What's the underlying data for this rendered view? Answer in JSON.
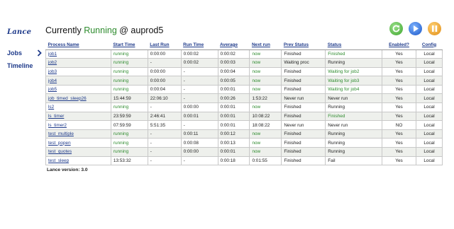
{
  "header": {
    "logo": "Lance",
    "title_prefix": "Currently",
    "status": "Running",
    "title_suffix": "@ auprod5"
  },
  "sidebar": {
    "items": [
      {
        "label": "Jobs"
      },
      {
        "label": "Timeline"
      }
    ]
  },
  "table": {
    "columns": [
      "Process Name",
      "Start Time",
      "Last Run",
      "Run Time",
      "Average",
      "Next run",
      "Prev Status",
      "Status",
      "Enabled?",
      "Config"
    ],
    "rows": [
      [
        "job1",
        "running",
        "0:00:00",
        "0:00:02",
        "0:00:02",
        "now",
        "Finished",
        "Finished",
        "Yes",
        "Local"
      ],
      [
        "job2",
        "running",
        "-",
        "0:00:02",
        "0:00:03",
        "now",
        "Waiting proc",
        "Running",
        "Yes",
        "Local"
      ],
      [
        "job3",
        "running",
        "0:00:00",
        "-",
        "0:00:04",
        "now",
        "Finished",
        "Waiting for job2",
        "Yes",
        "Local"
      ],
      [
        "job4",
        "running",
        "0:00:00",
        "-",
        "0:00:05",
        "now",
        "Finished",
        "Waiting for job3",
        "Yes",
        "Local"
      ],
      [
        "job5",
        "running",
        "0:00:04",
        "-",
        "0:00:01",
        "now",
        "Finished",
        "Waiting for job4",
        "Yes",
        "Local"
      ],
      [
        "job_timed_sleep26",
        "15:44:59",
        "22:06:10",
        "-",
        "0:00:26",
        "1:53:22",
        "Never run",
        "Never run",
        "Yes",
        "Local"
      ],
      [
        "ls2",
        "running",
        "-",
        "0:00:00",
        "0:00:01",
        "now",
        "Finished",
        "Running",
        "Yes",
        "Local"
      ],
      [
        "ls_timer",
        "23:59:59",
        "2:46:41",
        "0:00:01",
        "0:00:01",
        "10:08:22",
        "Finished",
        "Finished",
        "Yes",
        "Local"
      ],
      [
        "ls_timer2",
        "07:59:59",
        "5:51:35",
        "-",
        "0:00:01",
        "18:08:22",
        "Never run",
        "Never run",
        "NO",
        "Local"
      ],
      [
        "test_multiple",
        "running",
        "-",
        "0:00:11",
        "0:00:12",
        "now",
        "Finished",
        "Running",
        "Yes",
        "Local"
      ],
      [
        "test_popen",
        "running",
        "-",
        "0:00:08",
        "0:00:13",
        "now",
        "Finished",
        "Running",
        "Yes",
        "Local"
      ],
      [
        "test_quotes",
        "running",
        "-",
        "0:00:00",
        "0:00:01",
        "now",
        "Finished",
        "Running",
        "Yes",
        "Local"
      ],
      [
        "test_sleep",
        "13:53:32",
        "-",
        "-",
        "0:00:18",
        "0:01:55",
        "Finished",
        "Fail",
        "Yes",
        "Local"
      ]
    ]
  },
  "footer": {
    "version": "Lance version: 3.0"
  },
  "colors": {
    "accent": "#1e3a8a",
    "running": "#2e8b2e",
    "row_alt": "#eef0ec"
  },
  "icons": [
    "refresh-icon",
    "play-icon",
    "pause-icon",
    "chevron-right-icon"
  ]
}
